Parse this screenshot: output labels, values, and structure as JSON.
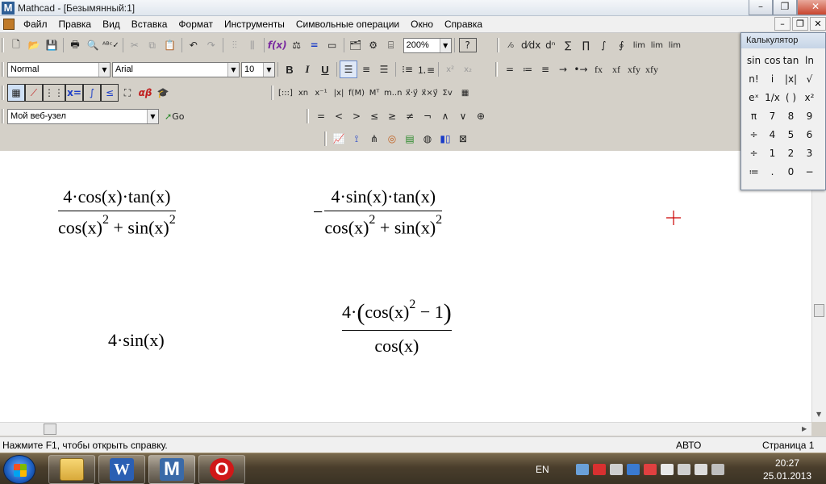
{
  "window": {
    "title": "Mathcad - [Безымянный:1]",
    "logo": "M",
    "buttons": [
      "minimize",
      "restore",
      "close"
    ]
  },
  "menubar": {
    "items": [
      "Файл",
      "Правка",
      "Вид",
      "Вставка",
      "Формат",
      "Инструменты",
      "Символьные операции",
      "Окно",
      "Справка"
    ]
  },
  "toolbar_standard": {
    "zoom": "200%",
    "help": "?"
  },
  "toolbar_format": {
    "style": "Normal",
    "font": "Arial",
    "size": "10",
    "bold": "B",
    "italic": "I",
    "underline": "U"
  },
  "toolbar_symbolic": {
    "items": [
      "=",
      "≔",
      "≡",
      "→",
      "•→",
      "fx",
      "xf",
      "xfy",
      "xfy"
    ]
  },
  "toolbar_math": {
    "x_eq": "x="
  },
  "toolbar_matrix": {
    "items": [
      "[:::]",
      "xn",
      "x⁻¹",
      "|x|",
      "f(M)",
      "Mᵀ",
      "m..n",
      "x⃗·y⃗",
      "x⃗×y⃗",
      "Σv",
      "▦"
    ]
  },
  "toolbar_web": {
    "address": "Мой веб-узел",
    "go": "Go"
  },
  "toolbar_boolean": {
    "items": [
      "=",
      "<",
      ">",
      "≤",
      "≥",
      "≠",
      "¬",
      "∧",
      "∨",
      "⊕"
    ]
  },
  "calculator": {
    "title": "Калькулятор",
    "keys": [
      "sin",
      "cos",
      "tan",
      "ln",
      "n!",
      "i",
      "|x|",
      "√",
      "eˣ",
      "1/x",
      "( )",
      "x²",
      "π",
      "7",
      "8",
      "9",
      "÷",
      "4",
      "5",
      "6",
      "÷",
      "1",
      "2",
      "3",
      "≔",
      ".",
      "0",
      "−"
    ]
  },
  "document": {
    "expr1": {
      "num": "4·cos(x)·tan(x)",
      "den_a": "cos(x)",
      "den_b": " + sin(x)",
      "exp": "2"
    },
    "expr2": {
      "sign": "−",
      "num": "4·sin(x)·tan(x)",
      "den_a": "cos(x)",
      "den_b": " + sin(x)",
      "exp": "2"
    },
    "expr3": "4·sin(x)",
    "expr4": {
      "num_a": "4·",
      "num_b": "cos(x)",
      "num_c": " − 1",
      "exp": "2",
      "den": "cos(x)"
    }
  },
  "statusbar": {
    "help": "Нажмите F1, чтобы открыть справку.",
    "mode": "АВТО",
    "page": "Страница 1"
  },
  "taskbar": {
    "apps": [
      "explorer",
      "word",
      "mathcad",
      "opera"
    ],
    "word_glyph": "W",
    "mathcad_glyph": "M",
    "opera_glyph": "O",
    "lang": "EN",
    "time": "20:27",
    "date": "25.01.2013"
  },
  "colors": {
    "crosshair": "#cc0000",
    "taskbar": "#4a3e2c"
  }
}
